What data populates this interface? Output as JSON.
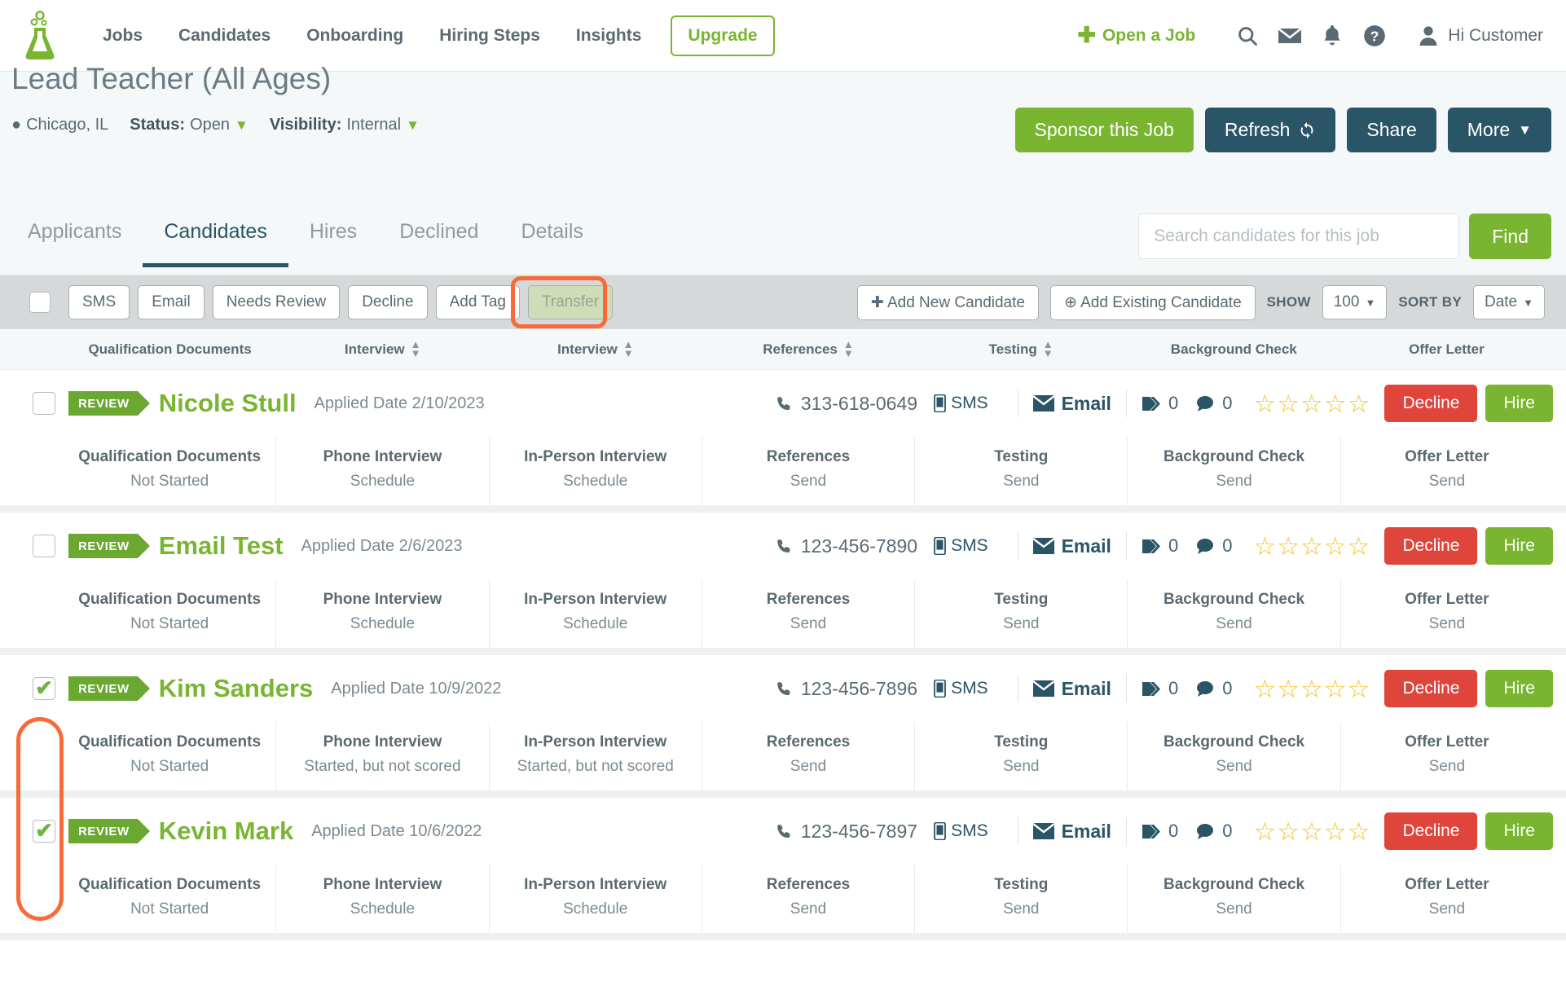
{
  "nav": {
    "logo_icon": "beaker-logo-icon",
    "links": [
      {
        "label": "Jobs"
      },
      {
        "label": "Candidates"
      },
      {
        "label": "Onboarding"
      },
      {
        "label": "Hiring Steps"
      },
      {
        "label": "Insights"
      }
    ],
    "upgrade_label": "Upgrade",
    "open_job_label": "Open a Job",
    "icons": [
      "search-icon",
      "envelope-icon",
      "bell-icon",
      "help-icon"
    ],
    "user_greeting": "Hi Customer"
  },
  "job": {
    "title": "Lead Teacher (All Ages)",
    "location": "Chicago, IL",
    "status_label": "Status:",
    "status_value": "Open",
    "visibility_label": "Visibility:",
    "visibility_value": "Internal",
    "actions": {
      "sponsor": "Sponsor this Job",
      "refresh": "Refresh",
      "share": "Share",
      "more": "More"
    }
  },
  "tabs": [
    {
      "label": "Applicants",
      "active": false
    },
    {
      "label": "Candidates",
      "active": true
    },
    {
      "label": "Hires",
      "active": false
    },
    {
      "label": "Declined",
      "active": false
    },
    {
      "label": "Details",
      "active": false
    }
  ],
  "search": {
    "placeholder": "Search candidates for this job",
    "value": "",
    "find_label": "Find"
  },
  "toolbar": {
    "buttons": [
      "SMS",
      "Email",
      "Needs Review",
      "Decline",
      "Add Tag"
    ],
    "transfer_label": "Transfer",
    "add_new_label": "Add New Candidate",
    "add_existing_label": "Add Existing Candidate",
    "show_label": "SHOW",
    "show_value": "100",
    "sort_label": "SORT BY",
    "sort_value": "Date"
  },
  "column_headers": [
    {
      "label": "Qualification Documents",
      "sortable": false
    },
    {
      "label": "Interview",
      "sortable": true
    },
    {
      "label": "Interview",
      "sortable": true
    },
    {
      "label": "References",
      "sortable": true
    },
    {
      "label": "Testing",
      "sortable": true
    },
    {
      "label": "Background Check",
      "sortable": false
    },
    {
      "label": "Offer Letter",
      "sortable": false
    }
  ],
  "row_labels": {
    "sms": "SMS",
    "email": "Email",
    "decline": "Decline",
    "hire": "Hire",
    "applied_prefix": "Applied Date",
    "badge": "REVIEW"
  },
  "candidates": [
    {
      "checked": false,
      "badge": "REVIEW",
      "name": "Nicole Stull",
      "applied": "Applied Date 2/10/2023",
      "phone": "313-618-0649",
      "tags": "0",
      "comments": "0",
      "rating": 0,
      "steps": [
        {
          "name": "Qualification Documents",
          "value": "Not Started"
        },
        {
          "name": "Phone Interview",
          "value": "Schedule"
        },
        {
          "name": "In-Person Interview",
          "value": "Schedule"
        },
        {
          "name": "References",
          "value": "Send"
        },
        {
          "name": "Testing",
          "value": "Send"
        },
        {
          "name": "Background Check",
          "value": "Send"
        },
        {
          "name": "Offer Letter",
          "value": "Send"
        }
      ]
    },
    {
      "checked": false,
      "badge": "REVIEW",
      "name": "Email Test",
      "applied": "Applied Date 2/6/2023",
      "phone": "123-456-7890",
      "tags": "0",
      "comments": "0",
      "rating": 0,
      "steps": [
        {
          "name": "Qualification Documents",
          "value": "Not Started"
        },
        {
          "name": "Phone Interview",
          "value": "Schedule"
        },
        {
          "name": "In-Person Interview",
          "value": "Schedule"
        },
        {
          "name": "References",
          "value": "Send"
        },
        {
          "name": "Testing",
          "value": "Send"
        },
        {
          "name": "Background Check",
          "value": "Send"
        },
        {
          "name": "Offer Letter",
          "value": "Send"
        }
      ]
    },
    {
      "checked": true,
      "badge": "REVIEW",
      "name": "Kim Sanders",
      "applied": "Applied Date 10/9/2022",
      "phone": "123-456-7896",
      "tags": "0",
      "comments": "0",
      "rating": 0,
      "steps": [
        {
          "name": "Qualification Documents",
          "value": "Not Started"
        },
        {
          "name": "Phone Interview",
          "value": "Started, but not scored"
        },
        {
          "name": "In-Person Interview",
          "value": "Started, but not scored"
        },
        {
          "name": "References",
          "value": "Send"
        },
        {
          "name": "Testing",
          "value": "Send"
        },
        {
          "name": "Background Check",
          "value": "Send"
        },
        {
          "name": "Offer Letter",
          "value": "Send"
        }
      ]
    },
    {
      "checked": true,
      "badge": "REVIEW",
      "name": "Kevin Mark",
      "applied": "Applied Date 10/6/2022",
      "phone": "123-456-7897",
      "tags": "0",
      "comments": "0",
      "rating": 0,
      "steps": [
        {
          "name": "Qualification Documents",
          "value": "Not Started"
        },
        {
          "name": "Phone Interview",
          "value": "Schedule"
        },
        {
          "name": "In-Person Interview",
          "value": "Schedule"
        },
        {
          "name": "References",
          "value": "Send"
        },
        {
          "name": "Testing",
          "value": "Send"
        },
        {
          "name": "Background Check",
          "value": "Send"
        },
        {
          "name": "Offer Letter",
          "value": "Send"
        }
      ]
    }
  ],
  "annotations": {
    "transfer_highlight_color": "#f96a38",
    "checkbox_highlight_color": "#f96a38"
  },
  "colors": {
    "brand_green": "#79b530",
    "dark_teal": "#2a5566",
    "decline_red": "#e0453c",
    "star_gold": "#f5c022",
    "toolbar_gray": "#d6d9da"
  }
}
